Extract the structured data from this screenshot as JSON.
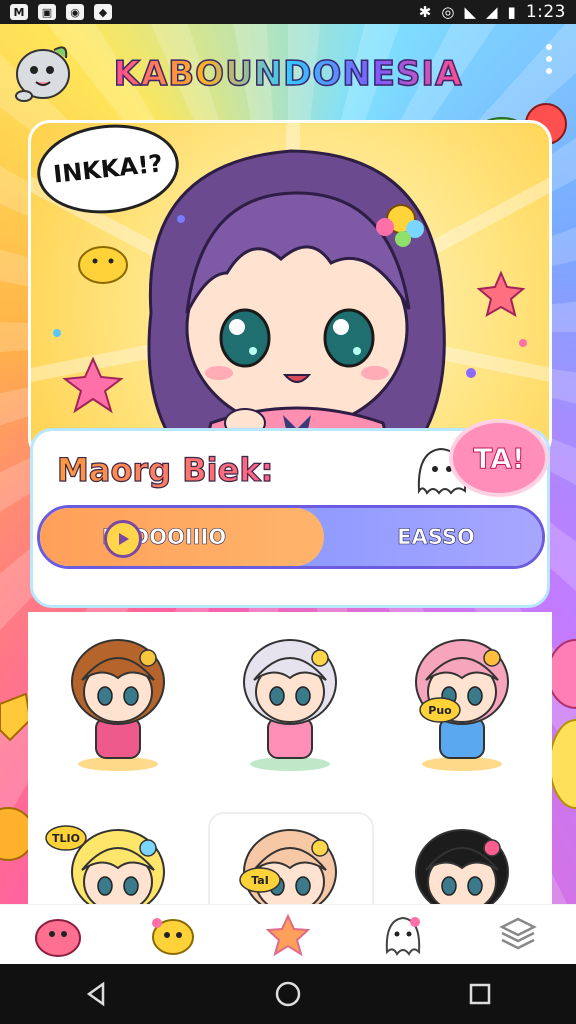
{
  "status_bar": {
    "time": "1:23",
    "left_icons": [
      "notification-icon",
      "image-icon",
      "notification-icon",
      "notification-icon"
    ],
    "right_icons": [
      "bluetooth-icon",
      "vibrate-icon",
      "wifi-icon",
      "signal-icon",
      "battery-icon"
    ]
  },
  "header": {
    "title": "KABOUNDONESIA"
  },
  "hero": {
    "speech_text": "INKKA!?"
  },
  "panel": {
    "title": "Maorg Biek:",
    "badge_text": "TA!",
    "segments": {
      "left_label": "PEDOOIIIO",
      "right_label": "EASSO"
    }
  },
  "gallery": {
    "items": [
      {
        "hair": "#b5652c",
        "outfit": "#ef5a8d",
        "accent": "#f6c63d"
      },
      {
        "hair": "#e6e2ee",
        "outfit": "#ff8fb7",
        "accent": "#ffd54a"
      },
      {
        "hair": "#f6a5bd",
        "outfit": "#5aa8ef",
        "accent": "#ffbf3c"
      },
      {
        "hair": "#ffe56a",
        "outfit": "#ef5a5a",
        "accent": "#7ad6ff"
      },
      {
        "hair": "#f7c8a5",
        "outfit": "#6fc2ff",
        "accent": "#ffd54a"
      },
      {
        "hair": "#1c1c1c",
        "outfit": "#ffffff",
        "accent": "#ff5f8f"
      }
    ],
    "speech_labels": [
      "Puo",
      "TLIO",
      "TaI"
    ]
  },
  "bottom_nav": [
    {
      "icon": "pink-creature-icon"
    },
    {
      "icon": "yellow-creature-icon"
    },
    {
      "icon": "star-icon"
    },
    {
      "icon": "ghost-icon"
    },
    {
      "icon": "layers-icon"
    }
  ],
  "system_nav": [
    "back-icon",
    "home-icon",
    "recents-icon"
  ],
  "colors": {
    "accent_orange": "#ffa55f",
    "accent_purple": "#6b5be0",
    "accent_pink": "#ff5f8f"
  }
}
